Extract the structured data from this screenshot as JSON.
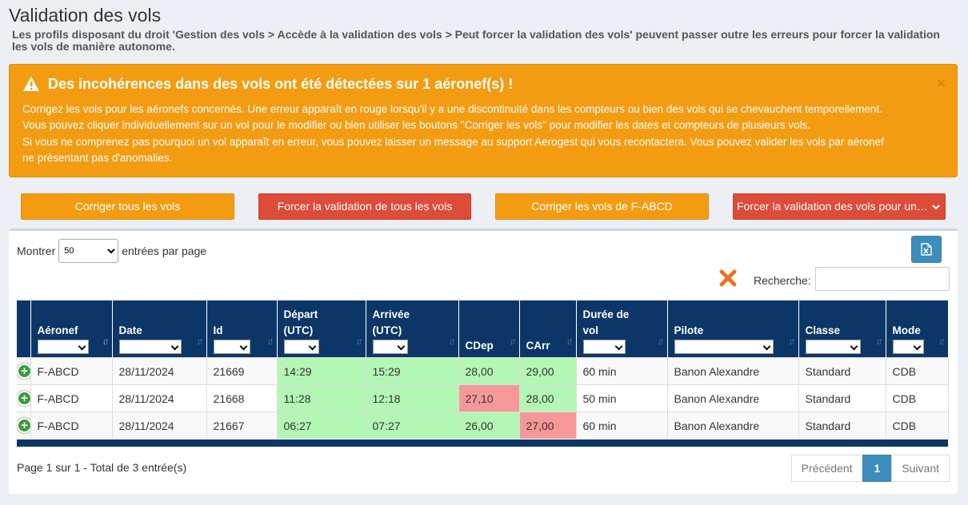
{
  "page": {
    "title": "Validation des vols",
    "subtitle": "Les profils disposant du droit 'Gestion des vols > Accède à la validation des vols > Peut forcer la validation des vols' peuvent passer outre les erreurs pour forcer la validation les vols de manière autonome."
  },
  "alert": {
    "title": "Des incohérences dans des vols ont été détectées sur 1 aéronef(s) !",
    "lines": [
      "Corrigez les vols pour les aéronefs concernés. Une erreur apparaît en rouge lorsqu'il y a une discontinuité dans les compteurs ou bien des vols qui se chevauchent temporellement.",
      "Vous pouvez cliquer individuellement sur un vol pour le modifier ou bien utiliser les boutons \"Corriger les vols\" pour modifier les dates et compteurs de plusieurs vols.",
      "Si vous ne comprenez pas pourquoi un vol apparaît en erreur, vous pouvez laisser un message au support Aerogest qui vous recontactera. Vous pouvez valider les vols par aéronef",
      "ne présentant pas d'anomalies."
    ],
    "close": "×"
  },
  "actions": {
    "fix_all": "Corriger tous les vols",
    "force_all": "Forcer la validation de tous les vols",
    "fix_aircraft": "Corriger les vols de F-ABCD",
    "force_aircraft": "Forcer la validation des vols pour un aéronef"
  },
  "table_controls": {
    "show_label": "Montrer",
    "page_size": "50",
    "per_page_label": "entrées par page",
    "search_label": "Recherche:",
    "search_value": ""
  },
  "columns": [
    {
      "l1": "",
      "l2": "Aéronef"
    },
    {
      "l1": "",
      "l2": "Date"
    },
    {
      "l1": "",
      "l2": "Id"
    },
    {
      "l1": "Départ",
      "l2": "(UTC)"
    },
    {
      "l1": "Arrivée",
      "l2": "(UTC)"
    },
    {
      "l1": "",
      "l2": "CDep"
    },
    {
      "l1": "",
      "l2": "CArr"
    },
    {
      "l1": "Durée de",
      "l2": "vol"
    },
    {
      "l1": "",
      "l2": "Pilote"
    },
    {
      "l1": "",
      "l2": "Classe"
    },
    {
      "l1": "",
      "l2": "Mode"
    }
  ],
  "rows": [
    {
      "aeronef": "F-ABCD",
      "date": "28/11/2024",
      "id": "21669",
      "depart": "14:29",
      "arrivee": "15:29",
      "cdep": "28,00",
      "carr": "29,00",
      "duree": "60 min",
      "pilote": "Banon Alexandre",
      "classe": "Standard",
      "mode": "CDB"
    },
    {
      "aeronef": "F-ABCD",
      "date": "28/11/2024",
      "id": "21668",
      "depart": "11:28",
      "arrivee": "12:18",
      "cdep": "27,10",
      "carr": "28,00",
      "duree": "50 min",
      "pilote": "Banon Alexandre",
      "classe": "Standard",
      "mode": "CDB"
    },
    {
      "aeronef": "F-ABCD",
      "date": "28/11/2024",
      "id": "21667",
      "depart": "06:27",
      "arrivee": "07:27",
      "cdep": "26,00",
      "carr": "27,00",
      "duree": "60 min",
      "pilote": "Banon Alexandre",
      "classe": "Standard",
      "mode": "CDB"
    }
  ],
  "footer": {
    "info": "Page 1 sur 1 - Total de 3 entrée(s)",
    "prev": "Précédent",
    "page": "1",
    "next": "Suivant"
  },
  "colors": {
    "warning": "#f39c12",
    "danger": "#dd4b39",
    "header": "#0c3668",
    "ok_cell": "#b3f7b5",
    "error_cell": "#f79898",
    "primary": "#3c8dbc"
  }
}
